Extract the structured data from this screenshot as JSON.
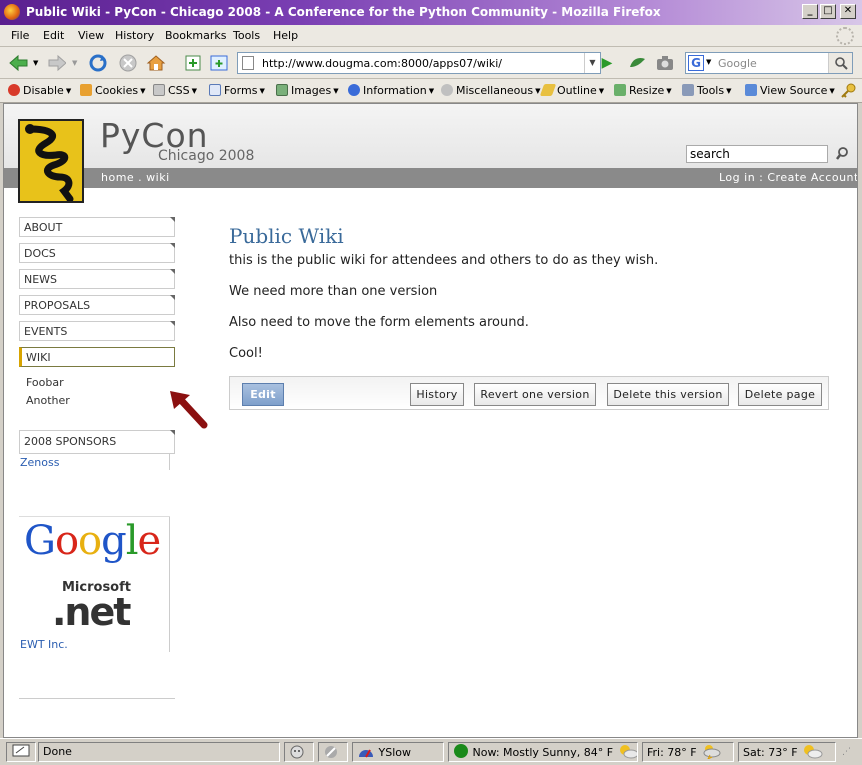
{
  "window": {
    "title": "Public Wiki - PyCon - Chicago 2008 - A Conference for the Python Community - Mozilla Firefox",
    "controls": {
      "minimize": "_",
      "maximize": "□",
      "close": "✕"
    }
  },
  "menu": {
    "items": [
      "File",
      "Edit",
      "View",
      "History",
      "Bookmarks",
      "Tools",
      "Help"
    ]
  },
  "nav": {
    "url": "http://www.dougma.com:8000/apps07/wiki/",
    "search_placeholder": "Google",
    "go_glyph": "▶"
  },
  "devtoolbar": {
    "items": [
      "Disable",
      "Cookies",
      "CSS",
      "Forms",
      "Images",
      "Information",
      "Miscellaneous",
      "Outline",
      "Resize",
      "Tools",
      "View Source"
    ]
  },
  "site": {
    "name": "PyCon",
    "subtitle": "Chicago 2008",
    "search_value": "search",
    "breadcrumb": "home . wiki",
    "account": "Log in : Create Account",
    "sidebar": [
      "ABOUT",
      "DOCS",
      "NEWS",
      "PROPOSALS",
      "EVENTS",
      "WIKI"
    ],
    "sub_links": [
      "Foobar",
      "Another"
    ],
    "sponsors_heading": "2008 SPONSORS",
    "sponsors": [
      "Zenoss",
      "EWT Inc."
    ],
    "google_letters": [
      "G",
      "o",
      "o",
      "g",
      "l",
      "e"
    ],
    "ms_text": "Microsoft",
    "net_text": ".net"
  },
  "wiki": {
    "title": "Public Wiki",
    "paragraphs": [
      "this is the public wiki for attendees and others to do as they wish.",
      "We need more than one version",
      "Also need to move the form elements around.",
      "Cool!"
    ],
    "buttons": {
      "edit": "Edit",
      "history": "History",
      "revert": "Revert one version",
      "delete_version": "Delete this version",
      "delete_page": "Delete page"
    }
  },
  "status": {
    "text": "Done",
    "yslow": "YSlow",
    "weather_now": "Now: Mostly Sunny, 84° F",
    "weather_fri": "Fri: 78° F",
    "weather_sat": "Sat: 73° F"
  },
  "colors": {
    "title_gradient_start": "#5a1f8f",
    "strip": "#8a8a8a",
    "logo_yellow": "#e8c21a",
    "wiki_title": "#3a6a9a",
    "arrow": "#8b1010"
  }
}
